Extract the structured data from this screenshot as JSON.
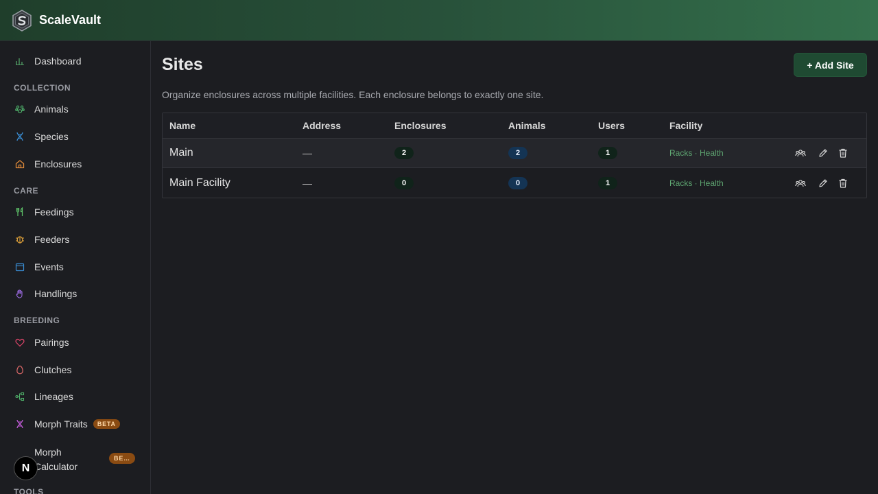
{
  "app": {
    "brand": "ScaleVault"
  },
  "sidebar": {
    "dashboard": "Dashboard",
    "sections": {
      "collection": "COLLECTION",
      "care": "CARE",
      "breeding": "BREEDING",
      "tools": "TOOLS"
    },
    "items": {
      "animals": "Animals",
      "species": "Species",
      "enclosures": "Enclosures",
      "feedings": "Feedings",
      "feeders": "Feeders",
      "events": "Events",
      "handlings": "Handlings",
      "pairings": "Pairings",
      "clutches": "Clutches",
      "lineages": "Lineages",
      "morph_traits": "Morph Traits",
      "morph_calculator_line1": "Morph",
      "morph_calculator_line2": "Calculator"
    },
    "badges": {
      "beta": "BETA",
      "beta_truncated": "BE…"
    },
    "avatar_letter": "N"
  },
  "page": {
    "title": "Sites",
    "add_button": "+ Add Site",
    "subtitle": "Organize enclosures across multiple facilities. Each enclosure belongs to exactly one site."
  },
  "table": {
    "headers": [
      "Name",
      "Address",
      "Enclosures",
      "Animals",
      "Users",
      "Facility"
    ],
    "rows": [
      {
        "name": "Main",
        "address": "—",
        "enclosures": "2",
        "animals": "2",
        "users": "1",
        "facility": "Racks · Health"
      },
      {
        "name": "Main Facility",
        "address": "—",
        "enclosures": "0",
        "animals": "0",
        "users": "1",
        "facility": "Racks · Health"
      }
    ]
  },
  "colors": {
    "accent_green": "#1f4a32",
    "facility_text": "#5fa772",
    "beta_badge": "#8a4b12"
  }
}
